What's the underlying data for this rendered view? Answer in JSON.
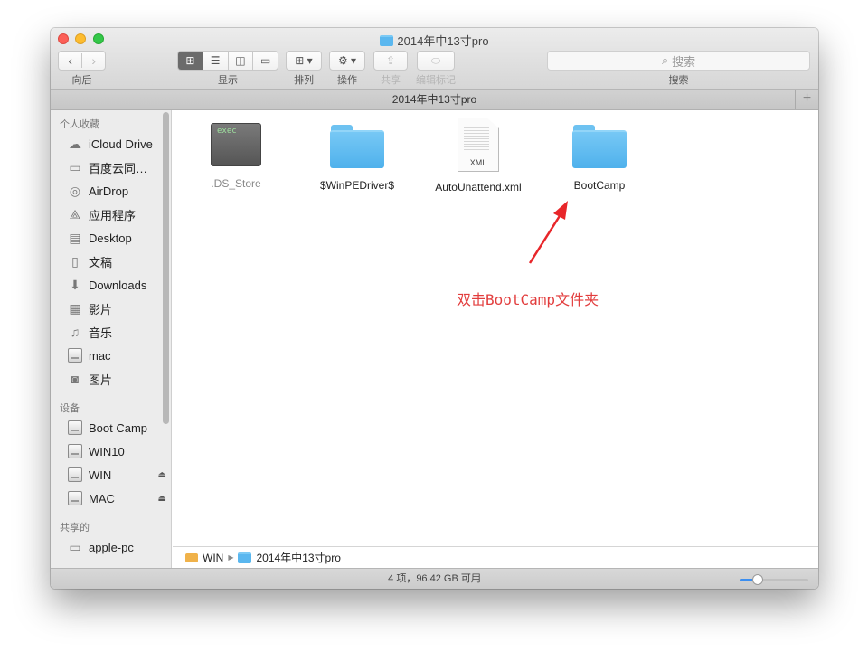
{
  "window": {
    "title": "2014年中13寸pro"
  },
  "toolbar": {
    "nav_label": "向后",
    "view_label": "显示",
    "arrange_label": "排列",
    "action_label": "操作",
    "share_label": "共享",
    "tags_label": "编辑标记",
    "search_label": "搜索",
    "search_placeholder": "搜索",
    "view_icons": [
      "icon-view-icon",
      "list-view-icon",
      "column-view-icon",
      "coverflow-view-icon"
    ]
  },
  "tab": {
    "title": "2014年中13寸pro",
    "add": "+"
  },
  "sidebar": {
    "favorites_title": "个人收藏",
    "favorites": [
      {
        "label": "iCloud Drive",
        "icon": "cloud-icon"
      },
      {
        "label": "百度云同…",
        "icon": "folder-icon"
      },
      {
        "label": "AirDrop",
        "icon": "airdrop-icon"
      },
      {
        "label": "应用程序",
        "icon": "applications-icon"
      },
      {
        "label": "Desktop",
        "icon": "desktop-icon"
      },
      {
        "label": "文稿",
        "icon": "documents-icon"
      },
      {
        "label": "Downloads",
        "icon": "downloads-icon"
      },
      {
        "label": "影片",
        "icon": "movies-icon"
      },
      {
        "label": "音乐",
        "icon": "music-icon"
      },
      {
        "label": "mac",
        "icon": "home-icon"
      },
      {
        "label": "图片",
        "icon": "pictures-icon"
      }
    ],
    "devices_title": "设备",
    "devices": [
      {
        "label": "Boot Camp",
        "eject": ""
      },
      {
        "label": "WIN10",
        "eject": ""
      },
      {
        "label": "WIN",
        "eject": "⏏"
      },
      {
        "label": "MAC",
        "eject": "⏏"
      }
    ],
    "shared_title": "共享的",
    "shared": [
      {
        "label": "apple-pc"
      }
    ]
  },
  "files": [
    {
      "name": ".DS_Store",
      "kind": "exec",
      "icon_text": "exec"
    },
    {
      "name": "$WinPEDriver$",
      "kind": "folder"
    },
    {
      "name": "AutoUnattend.xml",
      "kind": "xml",
      "icon_text": "XML"
    },
    {
      "name": "BootCamp",
      "kind": "folder"
    }
  ],
  "annotation": {
    "text": "双击BootCamp文件夹",
    "color": "#e23d3d"
  },
  "pathbar": {
    "root": "WIN",
    "folder": "2014年中13寸pro"
  },
  "status": {
    "text": "4 项，96.42 GB 可用",
    "icon_size_fraction": 0.2
  },
  "colors": {
    "close": "#fc5f57",
    "minimize": "#fdbc2e",
    "maximize": "#33c748",
    "folder": "#5ab7ef",
    "accent": "#3b8ef0"
  }
}
